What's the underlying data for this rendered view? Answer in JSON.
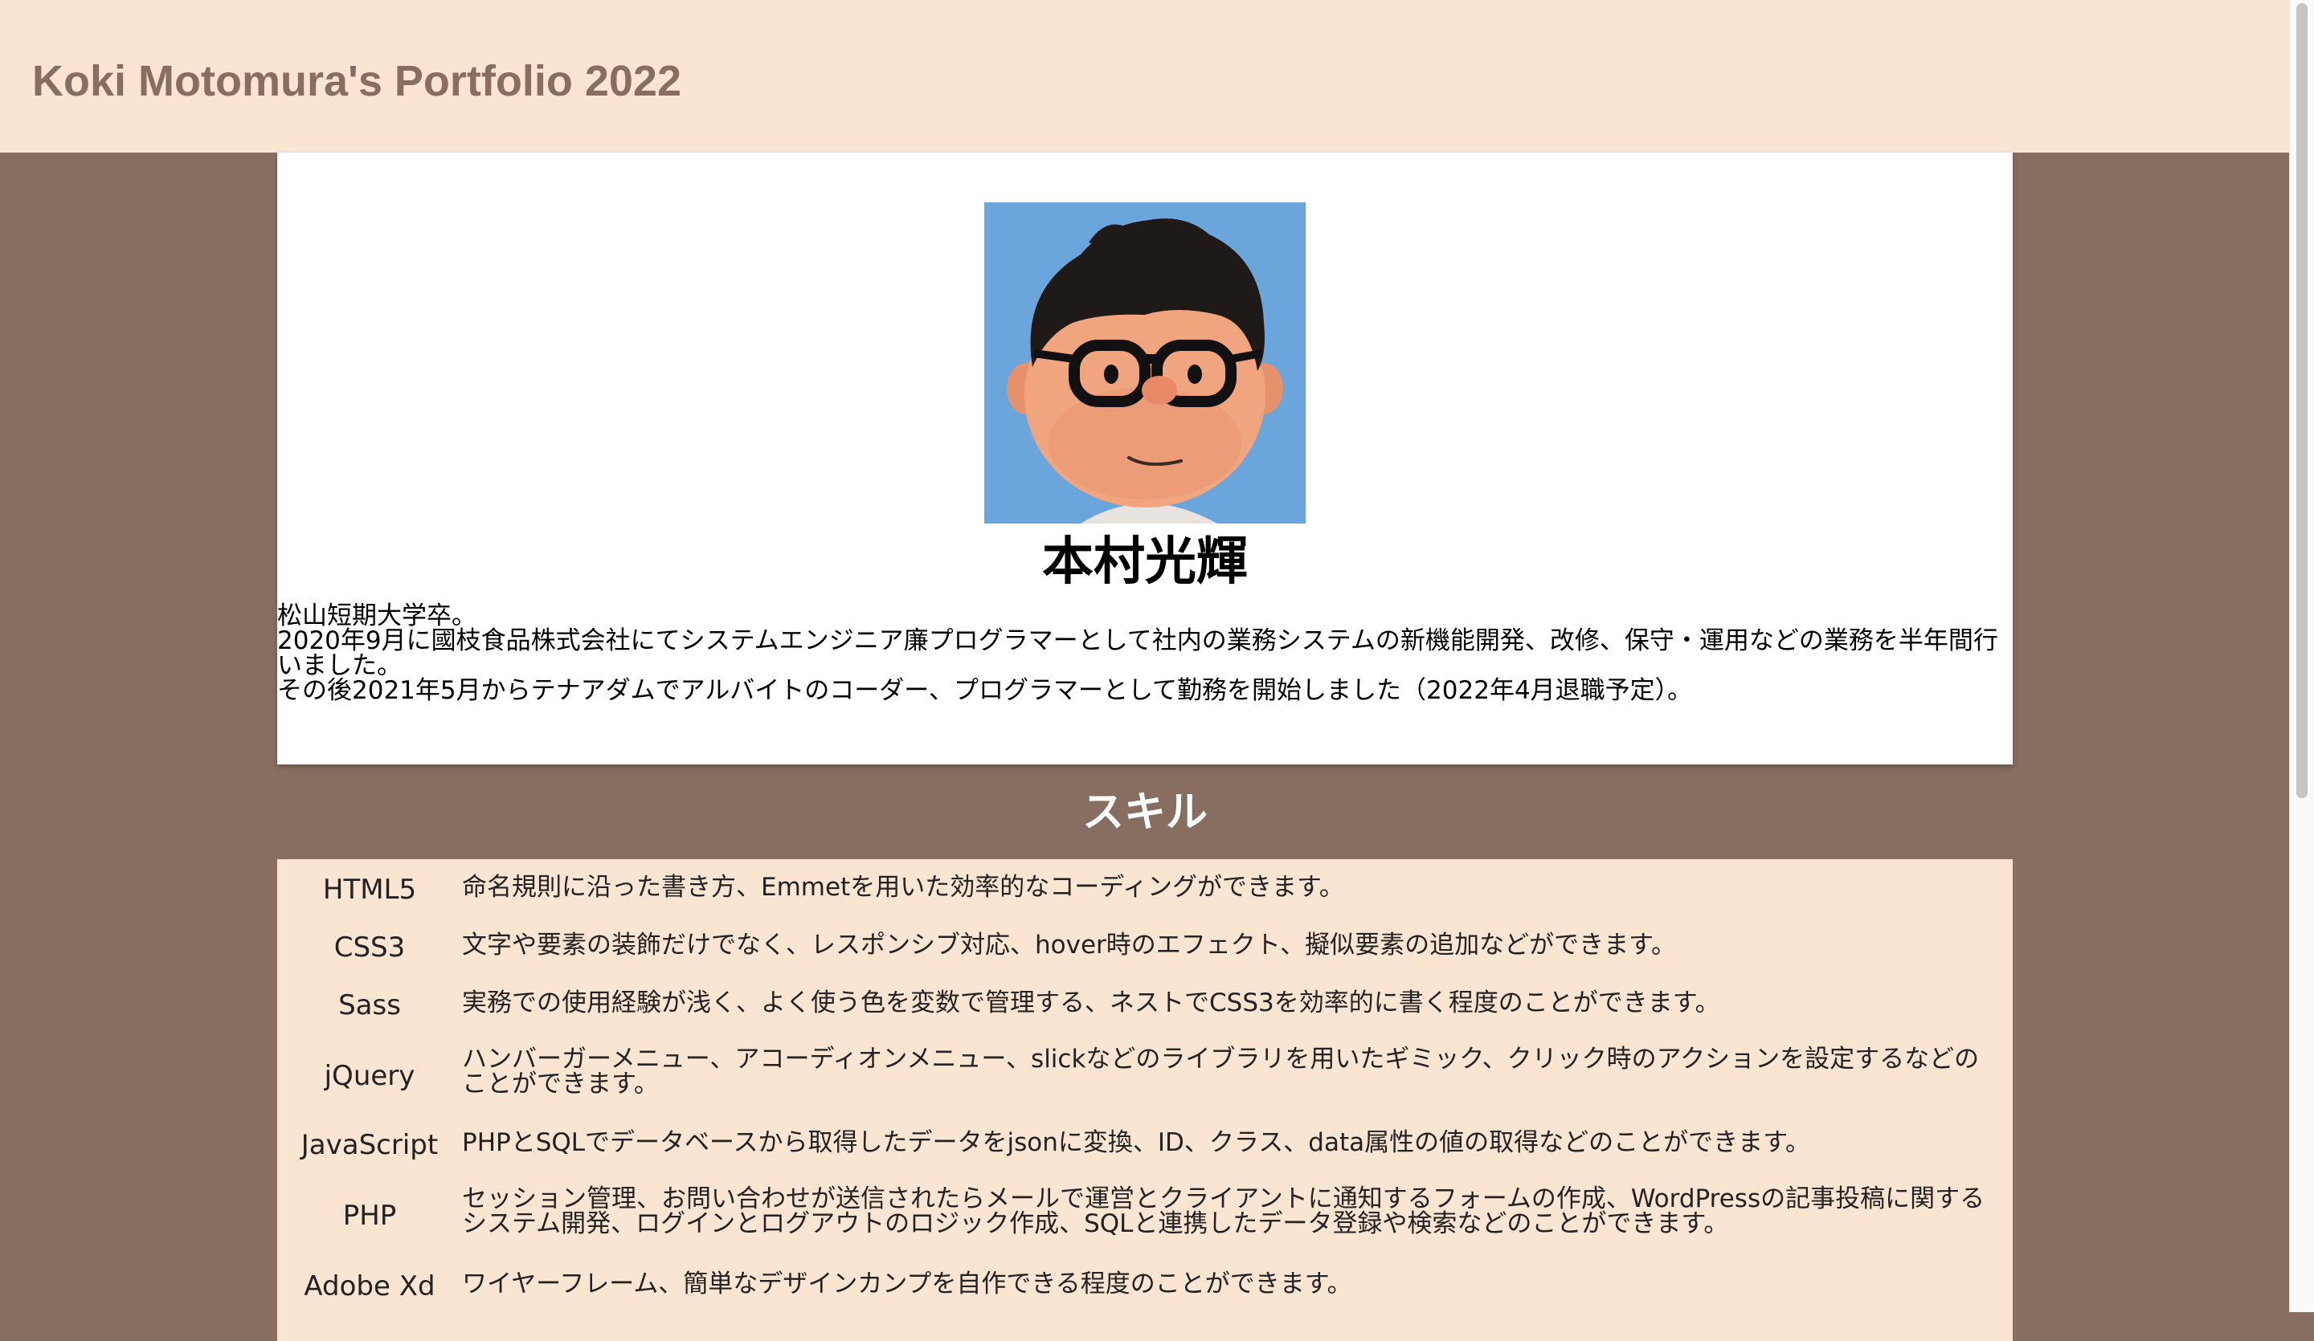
{
  "header": {
    "title": "Koki Motomura's Portfolio 2022"
  },
  "profile": {
    "name": "本村光輝",
    "bio": [
      "松山短期大学卒。",
      "2020年9月に國枝食品株式会社にてシステムエンジニア廉プログラマーとして社内の業務システムの新機能開発、改修、保守・運用などの業務を半年間行いました。",
      "その後2021年5月からテナアダムでアルバイトのコーダー、プログラマーとして勤務を開始しました（2022年4月退職予定）。"
    ]
  },
  "skills": {
    "title": "スキル",
    "items": [
      {
        "name": "HTML5",
        "desc": "命名規則に沿った書き方、Emmetを用いた効率的なコーディングができます。"
      },
      {
        "name": "CSS3",
        "desc": "文字や要素の装飾だけでなく、レスポンシブ対応、hover時のエフェクト、擬似要素の追加などができます。"
      },
      {
        "name": "Sass",
        "desc": "実務での使用経験が浅く、よく使う色を変数で管理する、ネストでCSS3を効率的に書く程度のことができます。"
      },
      {
        "name": "jQuery",
        "desc": "ハンバーガーメニュー、アコーディオンメニュー、slickなどのライブラリを用いたギミック、クリック時のアクションを設定するなどのことができます。"
      },
      {
        "name": "JavaScript",
        "desc": "PHPとSQLでデータベースから取得したデータをjsonに変換、ID、クラス、data属性の値の取得などのことができます。"
      },
      {
        "name": "PHP",
        "desc": "セッション管理、お問い合わせが送信されたらメールで運営とクライアントに通知するフォームの作成、WordPressの記事投稿に関するシステム開発、ログインとログアウトのロジック作成、SQLと連携したデータ登録や検索などのことができます。"
      },
      {
        "name": "Adobe Xd",
        "desc": "ワイヤーフレーム、簡単なデザインカンプを自作できる程度のことができます。"
      }
    ]
  },
  "colors": {
    "header_bg": "#fae5d3",
    "page_bg": "#886e61",
    "title_text": "#886e61",
    "avatar_bg": "#6aa5dc"
  }
}
